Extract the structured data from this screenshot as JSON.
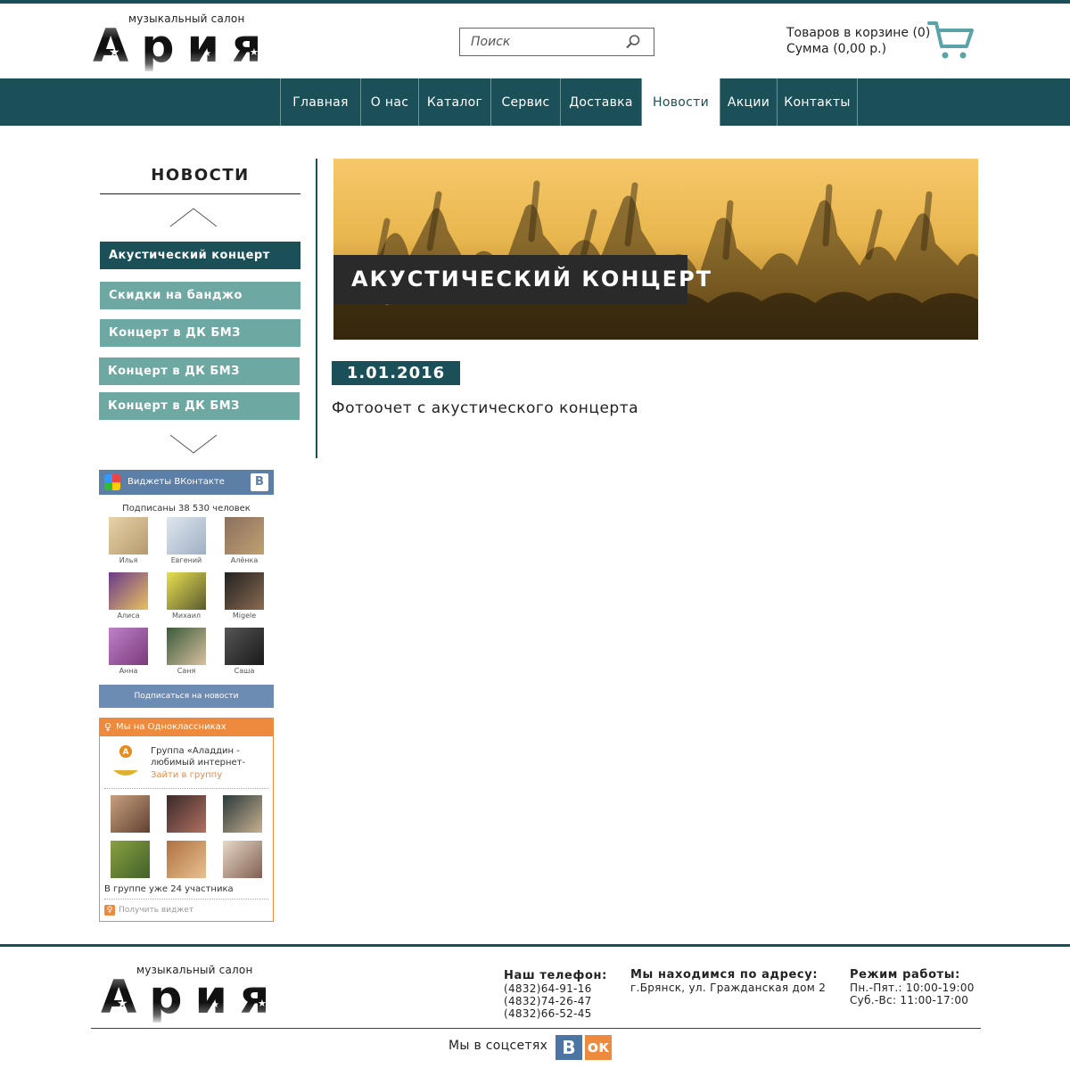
{
  "header": {
    "logo_subtitle": "музыкальный салон",
    "logo_word": "Ария",
    "search_placeholder": "Поиск",
    "cart_items": "Товаров в корзине (0)",
    "cart_sum": "Сумма (0,00 р.)"
  },
  "nav": {
    "items": [
      "Главная",
      "О нас",
      "Каталог",
      "Сервис",
      "Доставка",
      "Новости",
      "Акции",
      "Контакты"
    ],
    "active": "Новости"
  },
  "sidebar": {
    "title": "НОВОСТИ",
    "news": [
      "Акустический концерт",
      "Скидки на банджо",
      "Концерт в ДК БМЗ",
      "Концерт в ДК БМЗ",
      "Концерт в ДК БМЗ"
    ]
  },
  "article": {
    "title": "АКУСТИЧЕСКИЙ КОНЦЕРТ",
    "date": "1.01.2016",
    "text": "Фотоочет с акустического концерта"
  },
  "vk_widget": {
    "header": "Виджеты ВКонтакте",
    "badge": "В",
    "subscribers": "Подписаны 38 530 человек",
    "people": [
      "Илья",
      "Евгений",
      "Алёнка",
      "Алиса",
      "Михаил",
      "Migele",
      "Анна",
      "Саня",
      "Саша"
    ],
    "subscribe_button": "Подписаться на новости"
  },
  "ok_widget": {
    "header": "Мы на Одноклассниках",
    "group_name": "Группа «Аладдин - любимый интернет-",
    "join": "Зайти в группу",
    "members": "В группе уже 24 участника",
    "get_widget": "Получить виджет"
  },
  "footer": {
    "logo_subtitle": "музыкальный салон",
    "logo_word": "Ария",
    "phone_title": "Наш телефон:",
    "phones": [
      "(4832)64-91-16",
      "(4832)74-26-47",
      "(4832)66-52-45"
    ],
    "address_title": "Мы находимся по адресу:",
    "address": "г.Брянск, ул. Гражданская дом 2",
    "hours_title": "Режим работы:",
    "hours": [
      "Пн.-Пят.: 10:00-19:00",
      "Суб.-Вс: 11:00-17:00"
    ],
    "social_label": "Мы в соцсетях",
    "vk_badge": "В",
    "ok_badge": "ок"
  },
  "colors": {
    "primary": "#1b5058",
    "news_button": "#6ea8a2",
    "vk_blue": "#5b7fa6",
    "ok_orange": "#ee8a3d",
    "cart_icon": "#5aa3a6"
  }
}
